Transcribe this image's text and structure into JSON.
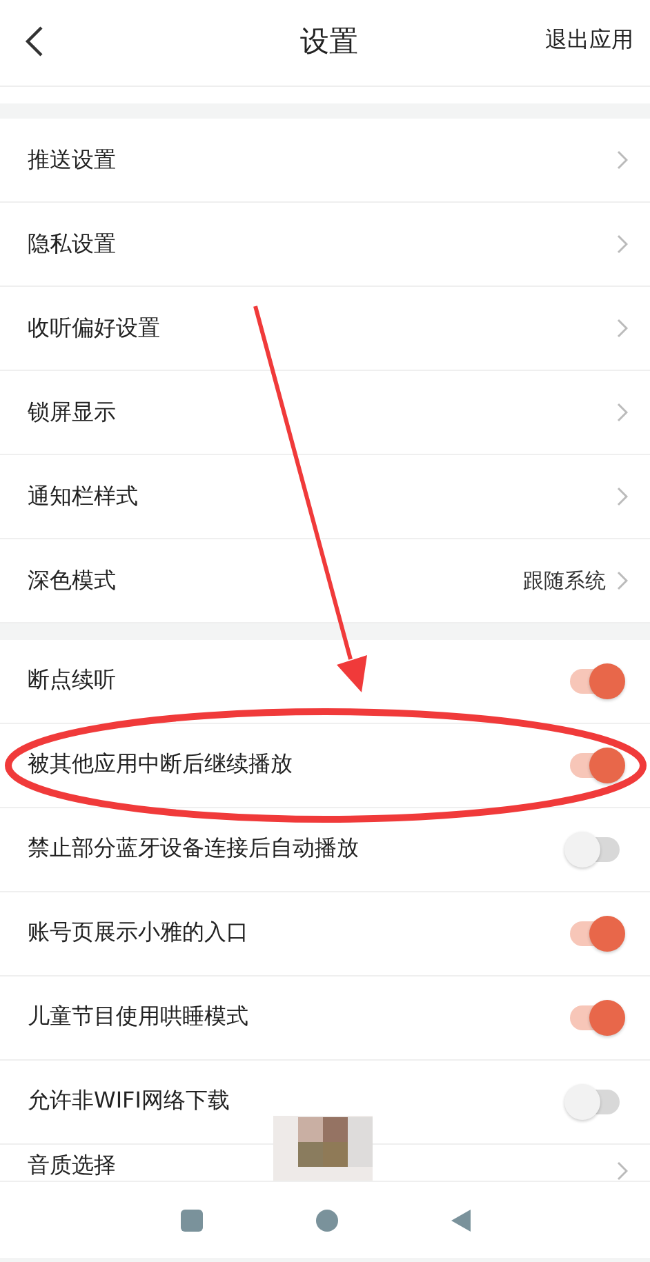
{
  "header": {
    "title": "设置",
    "action": "退出应用"
  },
  "groups": [
    {
      "rows": [
        {
          "kind": "link",
          "label": "推送设置"
        },
        {
          "kind": "link",
          "label": "隐私设置"
        },
        {
          "kind": "link",
          "label": "收听偏好设置"
        },
        {
          "kind": "link",
          "label": "锁屏显示"
        },
        {
          "kind": "link",
          "label": "通知栏样式"
        },
        {
          "kind": "link",
          "label": "深色模式",
          "value": "跟随系统"
        }
      ]
    },
    {
      "rows": [
        {
          "kind": "toggle",
          "label": "断点续听",
          "on": true
        },
        {
          "kind": "toggle",
          "label": "被其他应用中断后继续播放",
          "on": true
        },
        {
          "kind": "toggle",
          "label": "禁止部分蓝牙设备连接后自动播放",
          "on": false
        },
        {
          "kind": "toggle",
          "label": "账号页展示小雅的入口",
          "on": true
        },
        {
          "kind": "toggle",
          "label": "儿童节目使用哄睡模式",
          "on": true
        },
        {
          "kind": "toggle",
          "label": "允许非WIFI网络下载",
          "on": false
        },
        {
          "kind": "link",
          "label": "音质选择"
        }
      ]
    }
  ]
}
